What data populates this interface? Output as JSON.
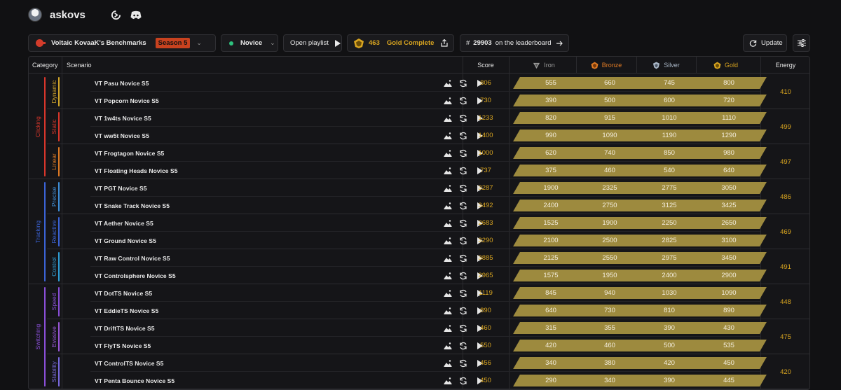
{
  "header": {
    "username": "askovs"
  },
  "toolbar": {
    "benchmark_title": "Voltaic KovaaK's Benchmarks",
    "season": "Season 5",
    "difficulty": "Novice",
    "open_playlist": "Open playlist",
    "gold_count": "463",
    "gold_label": "Gold Complete",
    "rank_hash": "#",
    "rank": "29903",
    "rank_label": "on the leaderboard",
    "update_label": "Update"
  },
  "table": {
    "headers": {
      "category": "Category",
      "scenario": "Scenario",
      "score": "Score",
      "energy": "Energy"
    },
    "ranks": [
      {
        "name": "Iron",
        "color": "#9a9a9a"
      },
      {
        "name": "Bronze",
        "color": "#e07b24"
      },
      {
        "name": "Silver",
        "color": "#a9b6c6"
      },
      {
        "name": "Gold",
        "color": "#d9a520"
      }
    ],
    "categories": [
      {
        "name": "Clicking",
        "color": "#d9362b",
        "subs": [
          {
            "name": "Dynamic",
            "color": "#d4a82b",
            "energy": "410",
            "rows": [
              {
                "scenario": "VT Pasu Novice S5",
                "score": "806",
                "t": [
                  "555",
                  "660",
                  "745",
                  "800"
                ]
              },
              {
                "scenario": "VT Popcorn Novice S5",
                "score": "730",
                "t": [
                  "390",
                  "500",
                  "600",
                  "720"
                ]
              }
            ]
          },
          {
            "name": "Static",
            "color": "#d9362b",
            "energy": "499",
            "rows": [
              {
                "scenario": "VT 1w4ts Novice S5",
                "score": "1233",
                "t": [
                  "820",
                  "915",
                  "1010",
                  "1110"
                ]
              },
              {
                "scenario": "VT ww5t Novice S5",
                "score": "1400",
                "t": [
                  "990",
                  "1090",
                  "1190",
                  "1290"
                ]
              }
            ]
          },
          {
            "name": "Linear",
            "color": "#e07b24",
            "energy": "497",
            "rows": [
              {
                "scenario": "VT Frogtagon Novice S5",
                "score": "1000",
                "t": [
                  "620",
                  "740",
                  "850",
                  "980"
                ]
              },
              {
                "scenario": "VT Floating Heads Novice S5",
                "score": "737",
                "t": [
                  "375",
                  "460",
                  "540",
                  "640"
                ]
              }
            ]
          }
        ]
      },
      {
        "name": "Tracking",
        "color": "#3b63d6",
        "subs": [
          {
            "name": "Precise",
            "color": "#3f8fd8",
            "energy": "486",
            "rows": [
              {
                "scenario": "VT PGT Novice S5",
                "score": "3287",
                "t": [
                  "1900",
                  "2325",
                  "2775",
                  "3050"
                ]
              },
              {
                "scenario": "VT Snake Track Novice S5",
                "score": "3492",
                "t": [
                  "2400",
                  "2750",
                  "3125",
                  "3425"
                ]
              }
            ]
          },
          {
            "name": "Reactive",
            "color": "#3b63d6",
            "energy": "469",
            "rows": [
              {
                "scenario": "VT Aether Novice S5",
                "score": "2683",
                "t": [
                  "1525",
                  "1900",
                  "2250",
                  "2650"
                ]
              },
              {
                "scenario": "VT Ground Novice S5",
                "score": "3290",
                "t": [
                  "2100",
                  "2500",
                  "2825",
                  "3100"
                ]
              }
            ]
          },
          {
            "name": "Control",
            "color": "#2f9fd6",
            "energy": "491",
            "rows": [
              {
                "scenario": "VT Raw Control Novice S5",
                "score": "3885",
                "t": [
                  "2125",
                  "2550",
                  "2975",
                  "3450"
                ]
              },
              {
                "scenario": "VT Controlsphere Novice S5",
                "score": "2965",
                "t": [
                  "1575",
                  "1950",
                  "2400",
                  "2900"
                ]
              }
            ]
          }
        ]
      },
      {
        "name": "Switching",
        "color": "#8a4fd8",
        "subs": [
          {
            "name": "Speed",
            "color": "#8a4fd8",
            "energy": "448",
            "rows": [
              {
                "scenario": "VT DotTS Novice S5",
                "score": "1119",
                "t": [
                  "845",
                  "940",
                  "1030",
                  "1090"
                ]
              },
              {
                "scenario": "VT EddieTS Novice S5",
                "score": "890",
                "t": [
                  "640",
                  "730",
                  "810",
                  "890"
                ]
              }
            ]
          },
          {
            "name": "Evasive",
            "color": "#9a56d8",
            "energy": "475",
            "rows": [
              {
                "scenario": "VT DriftTS Novice S5",
                "score": "460",
                "t": [
                  "315",
                  "355",
                  "390",
                  "430"
                ]
              },
              {
                "scenario": "VT FlyTS Novice S5",
                "score": "550",
                "t": [
                  "420",
                  "460",
                  "500",
                  "535"
                ]
              }
            ]
          },
          {
            "name": "Stability",
            "color": "#7a6ae0",
            "energy": "420",
            "rows": [
              {
                "scenario": "VT ControlTS Novice S5",
                "score": "456",
                "t": [
                  "340",
                  "380",
                  "420",
                  "450"
                ]
              },
              {
                "scenario": "VT Penta Bounce Novice S5",
                "score": "450",
                "t": [
                  "290",
                  "340",
                  "390",
                  "445"
                ]
              }
            ]
          }
        ]
      }
    ]
  }
}
